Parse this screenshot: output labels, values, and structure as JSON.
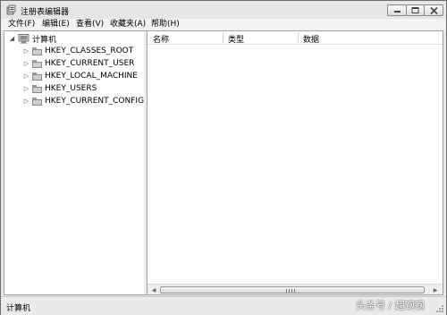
{
  "window": {
    "title": "注册表编辑器"
  },
  "menu": [
    "文件(F)",
    "编辑(E)",
    "查看(V)",
    "收藏夹(A)",
    "帮助(H)"
  ],
  "tree": {
    "root": "计算机",
    "children": [
      "HKEY_CLASSES_ROOT",
      "HKEY_CURRENT_USER",
      "HKEY_LOCAL_MACHINE",
      "HKEY_USERS",
      "HKEY_CURRENT_CONFIG"
    ]
  },
  "list": {
    "columns": [
      "名称",
      "类型",
      "数据"
    ]
  },
  "status": {
    "text": "计算机"
  },
  "watermark": "头条号 / 超钢钢",
  "icons": {
    "app": "registry-editor-icon",
    "minimize": "minimize-icon",
    "maximize": "maximize-icon",
    "close": "close-icon",
    "computer": "computer-icon",
    "folder": "folder-icon"
  }
}
